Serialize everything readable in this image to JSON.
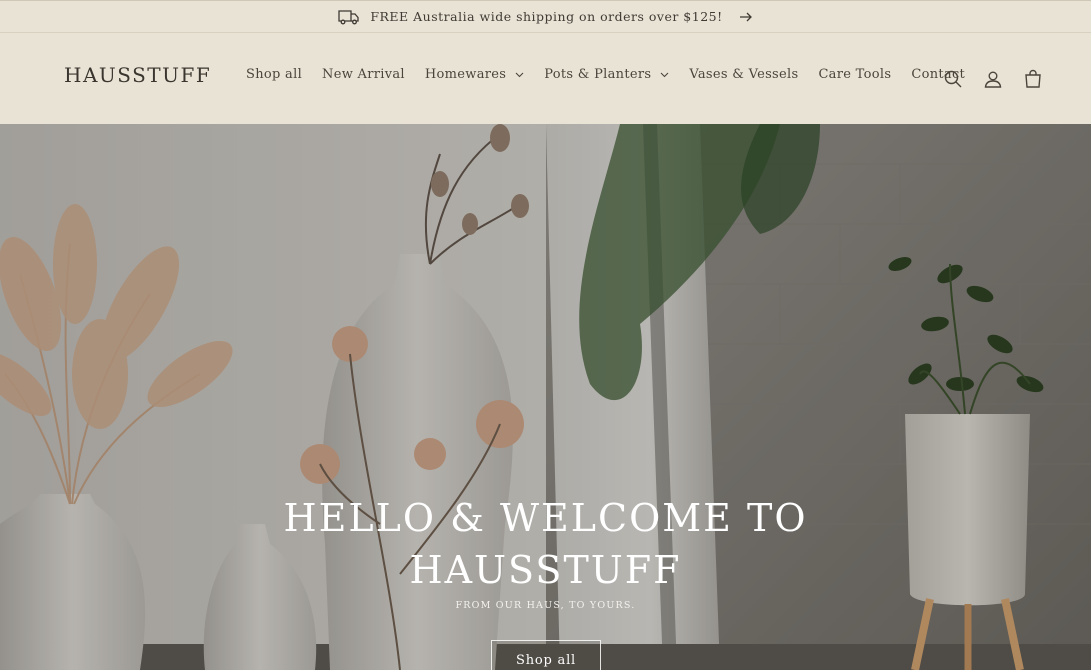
{
  "announcement": {
    "text": "FREE Australia wide shipping on orders over $125!",
    "icon": "truck-icon",
    "arrow_icon": "arrow-right-icon"
  },
  "header": {
    "logo": "HAUSSTUFF",
    "nav": [
      {
        "label": "Shop all",
        "dropdown": false
      },
      {
        "label": "New Arrival",
        "dropdown": false
      },
      {
        "label": "Homewares",
        "dropdown": true
      },
      {
        "label": "Pots & Planters",
        "dropdown": true
      },
      {
        "label": "Vases & Vessels",
        "dropdown": false
      },
      {
        "label": "Care Tools",
        "dropdown": false
      },
      {
        "label": "Contact",
        "dropdown": false
      }
    ],
    "icons": [
      "search-icon",
      "account-icon",
      "cart-icon"
    ]
  },
  "hero": {
    "title_line1": "HELLO & WELCOME TO",
    "title_line2": "HAUSSTUFF",
    "subtitle": "FROM OUR HAUS, TO YOURS.",
    "button": "Shop all"
  },
  "colors": {
    "header_bg": "#e9e3d6",
    "text": "#3a352e",
    "hero_text": "#ffffff"
  }
}
